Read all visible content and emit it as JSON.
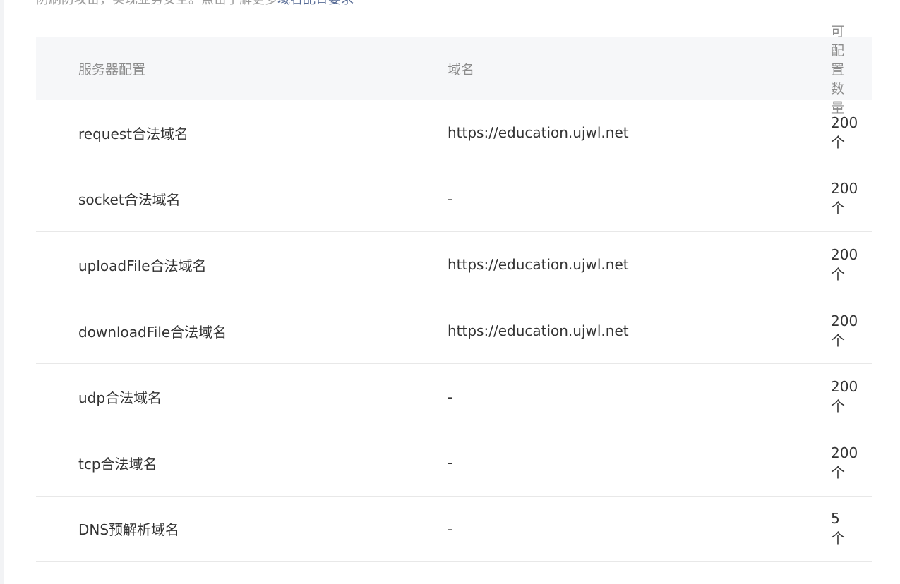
{
  "intro": {
    "text": "防刷防攻击，实现业务安全。点击了解更多",
    "link": "域名配置要求"
  },
  "table": {
    "headers": {
      "config": "服务器配置",
      "domain": "域名",
      "quota": "可配置数量"
    },
    "rows": [
      {
        "config": "request合法域名",
        "domain": "https://education.ujwl.net",
        "quota": "200个"
      },
      {
        "config": "socket合法域名",
        "domain": "-",
        "quota": "200个"
      },
      {
        "config": "uploadFile合法域名",
        "domain": "https://education.ujwl.net",
        "quota": "200个"
      },
      {
        "config": "downloadFile合法域名",
        "domain": "https://education.ujwl.net",
        "quota": "200个"
      },
      {
        "config": "udp合法域名",
        "domain": "-",
        "quota": "200个"
      },
      {
        "config": "tcp合法域名",
        "domain": "-",
        "quota": "200个"
      },
      {
        "config": "DNS预解析域名",
        "domain": "-",
        "quota": "5个"
      }
    ]
  }
}
